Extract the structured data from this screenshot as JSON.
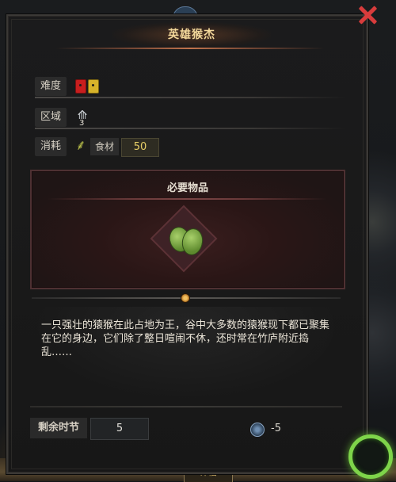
{
  "title": "英雄猴杰",
  "rows": {
    "difficulty_label": "难度",
    "region_label": "区域",
    "region_number": "3",
    "cost_label": "消耗",
    "food_label": "食材",
    "food_value": "50"
  },
  "required": {
    "title": "必要物品",
    "item_icon": "cactus-icon"
  },
  "description": "一只强壮的猿猴在此占地为王，谷中大多数的猿猴现下都已聚集在它的身边，它们除了整日喧闹不休，还时常在竹庐附近捣乱……",
  "remaining": {
    "label": "剩余时节",
    "value": "5"
  },
  "swirl_value": "-5",
  "bottom_tab": "评估",
  "colors": {
    "accent_title": "#f2d79a",
    "close": "#d83c3c",
    "food_value": "#e7cf67",
    "end_turn_ring": "#7ed44a"
  }
}
